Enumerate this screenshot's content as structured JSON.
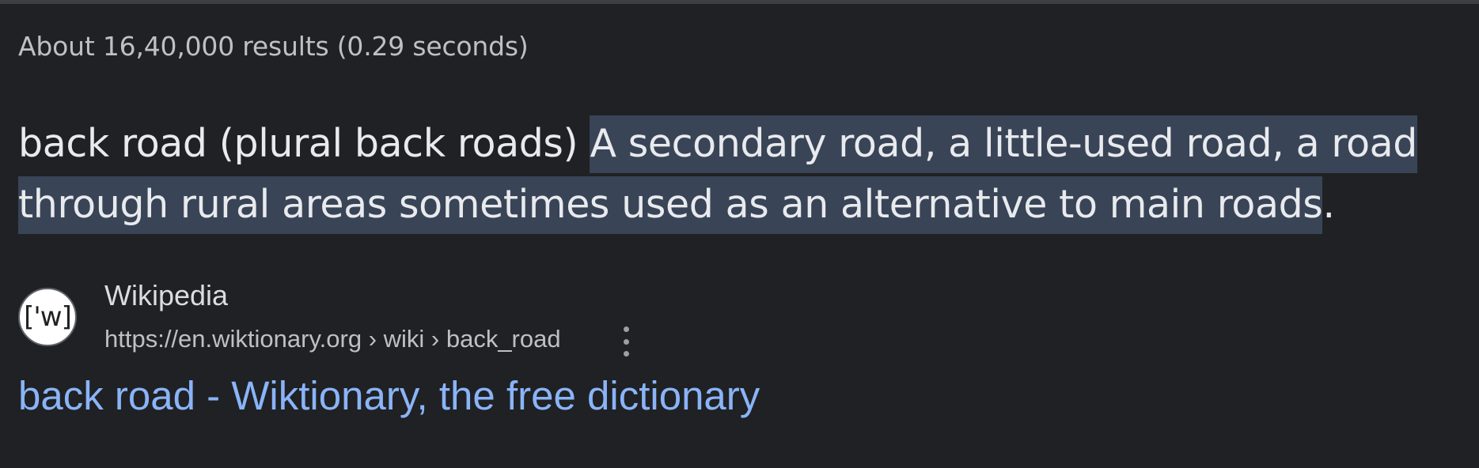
{
  "results_stats": "About 16,40,000 results (0.29 seconds)",
  "snippet": {
    "lead_text": "back road (plural back roads) ",
    "highlighted_text": "A secondary road, a little-used road, a road through rural areas sometimes used as an alternative to main roads",
    "trailing_text": "."
  },
  "result": {
    "favicon_text": "['w]",
    "site_name": "Wikipedia",
    "breadcrumb": "https://en.wiktionary.org › wiki › back_road",
    "title": "back road - Wiktionary, the free dictionary",
    "more_icon": "more-vert-icon"
  },
  "colors": {
    "background": "#202124",
    "text": "#e8eaed",
    "secondary_text": "#bdc1c6",
    "highlight": "#394457",
    "link": "#8ab4f8"
  }
}
